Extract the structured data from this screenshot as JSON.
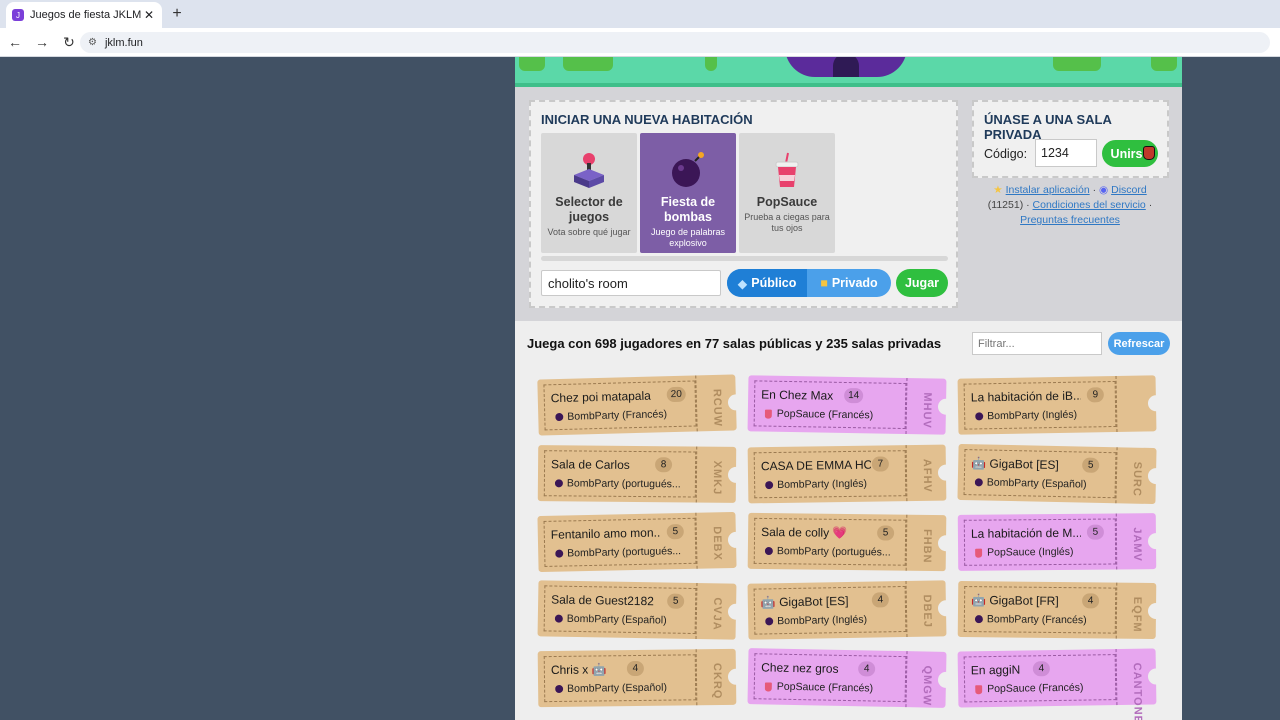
{
  "browser": {
    "tab_title": "Juegos de fiesta JKLM.FUN para",
    "tab_close": "✕",
    "new_tab": "+",
    "url": "jklm.fun"
  },
  "new_room": {
    "title": "INICIAR UNA NUEVA HABITACIÓN",
    "games": [
      {
        "name": "Selector de juegos",
        "desc": "Vota sobre qué jugar",
        "icon": "joystick-icon"
      },
      {
        "name": "Fiesta de bombas",
        "desc": "Juego de palabras explosivo",
        "icon": "bomb-icon"
      },
      {
        "name": "PopSauce",
        "desc": "Prueba a ciegas para tus ojos",
        "icon": "soda-cup-icon"
      }
    ],
    "room_name_value": "cholito's room",
    "public_label": "Público",
    "private_label": "Privado",
    "play_label": "Jugar"
  },
  "join_private": {
    "title": "ÚNASE A UNA SALA PRIVADA",
    "code_label": "Código:",
    "code_value": "1234",
    "join_label": "Unirse",
    "install_app": "Instalar aplicación",
    "discord": "Discord",
    "discord_count": "(11251)",
    "terms": "Condiciones del servicio",
    "faq": "Preguntas frecuentes"
  },
  "rooms": {
    "header": "Juega con 698 jugadores en 77 salas públicas y 235 salas privadas",
    "filter_placeholder": "Filtrar...",
    "refresh_label": "Refrescar",
    "list": [
      {
        "name": "Chez poi matapala",
        "count": "20",
        "game": "BombParty (Francés)",
        "code": "RCUW",
        "type": "bomb"
      },
      {
        "name": "En Chez Max",
        "count": "14",
        "game": "PopSauce (Francés)",
        "code": "MHUV",
        "type": "pop"
      },
      {
        "name": "La habitación de iB...",
        "count": "9",
        "game": "BombParty (Inglés)",
        "code": "",
        "type": "bomb"
      },
      {
        "name": "Sala de Carlos",
        "count": "8",
        "game": "BombParty (portugués...",
        "code": "XMKJ",
        "type": "bomb"
      },
      {
        "name": "CASA DE EMMA HO",
        "count": "7",
        "game": "BombParty (Inglés)",
        "code": "AFHV",
        "type": "bomb"
      },
      {
        "name": "🤖 GigaBot [ES]",
        "count": "5",
        "game": "BombParty (Español)",
        "code": "SURC",
        "type": "bomb"
      },
      {
        "name": "Fentanilo amo mon...",
        "count": "5",
        "game": "BombParty (portugués...",
        "code": "DEBX",
        "type": "bomb"
      },
      {
        "name": "Sala de colly 💗",
        "count": "5",
        "game": "BombParty (portugués...",
        "code": "FHBN",
        "type": "bomb"
      },
      {
        "name": "La habitación de M...",
        "count": "5",
        "game": "PopSauce (Inglés)",
        "code": "JAMV",
        "type": "pop"
      },
      {
        "name": "Sala de Guest2182",
        "count": "5",
        "game": "BombParty (Español)",
        "code": "CVJA",
        "type": "bomb"
      },
      {
        "name": "🤖 GigaBot [ES]",
        "count": "4",
        "game": "BombParty (Inglés)",
        "code": "DBEJ",
        "type": "bomb"
      },
      {
        "name": "🤖 GigaBot [FR]",
        "count": "4",
        "game": "BombParty (Francés)",
        "code": "EQFM",
        "type": "bomb"
      },
      {
        "name": "Chris x 🤖",
        "count": "4",
        "game": "BombParty (Español)",
        "code": "CKRQ",
        "type": "bomb"
      },
      {
        "name": "Chez nez gros",
        "count": "4",
        "game": "PopSauce (Francés)",
        "code": "QMGW",
        "type": "pop"
      },
      {
        "name": "En aggiN",
        "count": "4",
        "game": "PopSauce (Francés)",
        "code": "CANTONES",
        "type": "pop"
      }
    ]
  },
  "colors": {
    "bomb_ticket": "#e2c090",
    "pop_ticket": "#e7a6ef",
    "accent_green": "#2fbf3f",
    "accent_blue": "#4ba0ea",
    "selected_game": "#7d5ea6"
  }
}
